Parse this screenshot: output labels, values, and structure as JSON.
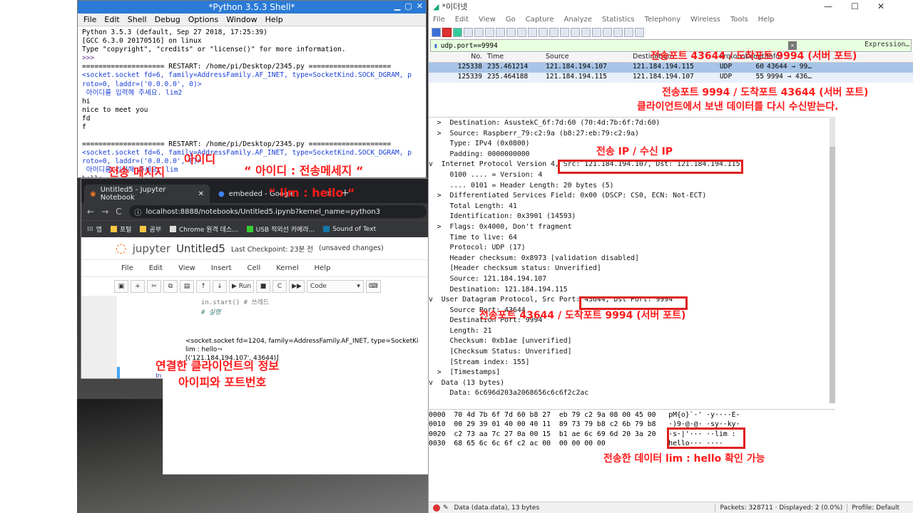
{
  "shell": {
    "title": "*Python 3.5.3 Shell*",
    "menu": [
      "File",
      "Edit",
      "Shell",
      "Debug",
      "Options",
      "Window",
      "Help"
    ],
    "lines": [
      {
        "t": "Python 3.5.3 (default, Sep 27 2018, 17:25:39)",
        "c": ""
      },
      {
        "t": "[GCC 6.3.0 20170516] on linux",
        "c": ""
      },
      {
        "t": "Type \"copyright\", \"credits\" or \"license()\" for more information.",
        "c": ""
      },
      {
        "t": ">>> ",
        "c": "purple"
      },
      {
        "t": "==================== RESTART: /home/pi/Desktop/2345.py ====================",
        "c": ""
      },
      {
        "t": "<socket.socket fd=6, family=AddressFamily.AF_INET, type=SocketKind.SOCK_DGRAM, p",
        "c": "blue"
      },
      {
        "t": "roto=0, laddr=('0.0.0.0', 0)>",
        "c": "blue"
      },
      {
        "t": " 아이디를 입력해 주세요. lim2",
        "c": "blue"
      },
      {
        "t": "hi",
        "c": ""
      },
      {
        "t": "nice to meet you",
        "c": ""
      },
      {
        "t": "fd",
        "c": ""
      },
      {
        "t": "f",
        "c": ""
      },
      {
        "t": "",
        "c": ""
      },
      {
        "t": "==================== RESTART: /home/pi/Desktop/2345.py ====================",
        "c": ""
      },
      {
        "t": "<socket.socket fd=6, family=AddressFamily.AF_INET, type=SocketKind.SOCK_DGRAM, p",
        "c": "blue"
      },
      {
        "t": "roto=0, laddr=('0.0.0.0', 0)>",
        "c": "blue"
      },
      {
        "t": " 아이디를 입력해 주세요. lim",
        "c": "blue"
      },
      {
        "t": "hello¬",
        "c": ""
      }
    ]
  },
  "chrome": {
    "tabs": [
      {
        "label": "Untitled5 - Jupyter Notebook",
        "close": "✕"
      },
      {
        "label": "embeded - Google",
        "close": "✕"
      }
    ],
    "new_tab": "+",
    "url": "localhost:8888/notebooks/Untitled5.ipynb?kernel_name=python3",
    "bookmarks": [
      "앱",
      "포털",
      "공부",
      "Chrome 원격 데스...",
      "USB 적외선 카메라...",
      "Sound of Text"
    ]
  },
  "jupyter": {
    "logo": "jupyter",
    "notebook_name": "Untitled5",
    "checkpoint": "Last Checkpoint: 23분 전",
    "status": "(unsaved changes)",
    "menu": [
      "File",
      "Edit",
      "View",
      "Insert",
      "Cell",
      "Kernel",
      "Help"
    ],
    "run_label": "Run",
    "cell_type": "Code",
    "code_lines": [
      "in.start() # 쓰레드",
      "# 실행"
    ],
    "output_lines": [
      "<socket.socket fd=1204, family=AddressFamily.AF_INET, type=SocketKi",
      "lim : hello¬",
      "[('121.184.194.107', 43644)]"
    ],
    "prompt": "In"
  },
  "wireshark": {
    "title": "*이더넷",
    "menu": [
      "File",
      "Edit",
      "View",
      "Go",
      "Capture",
      "Analyze",
      "Statistics",
      "Telephony",
      "Wireless",
      "Tools",
      "Help"
    ],
    "filter": "udp.port==9994",
    "expression": "Expression…",
    "columns": [
      "No.",
      "Time",
      "Source",
      "Destination",
      "Protocol",
      "Length",
      "Info"
    ],
    "packets": [
      {
        "no": "125338",
        "time": "235.461214",
        "src": "121.184.194.107",
        "dst": "121.184.194.115",
        "proto": "UDP",
        "len": "60",
        "info": "43644 → 99…"
      },
      {
        "no": "125339",
        "time": "235.464188",
        "src": "121.184.194.115",
        "dst": "121.184.194.107",
        "proto": "UDP",
        "len": "55",
        "info": "9994 → 436…"
      }
    ],
    "details": [
      "  >  Destination: AsustekC_6f:7d:60 (70:4d:7b:6f:7d:60)",
      "  >  Source: Raspberr_79:c2:9a (b8:27:eb:79:c2:9a)",
      "     Type: IPv4 (0x0800)",
      "     Padding: 0000000000",
      "v  Internet Protocol Version 4, Src: 121.184.194.107, Dst: 121.184.194.115",
      "     0100 .... = Version: 4",
      "     .... 0101 = Header Length: 20 bytes (5)",
      "  >  Differentiated Services Field: 0x00 (DSCP: CS0, ECN: Not-ECT)",
      "     Total Length: 41",
      "     Identification: 0x3901 (14593)",
      "  >  Flags: 0x4000, Don't fragment",
      "     Time to live: 64",
      "     Protocol: UDP (17)",
      "     Header checksum: 0x8973 [validation disabled]",
      "     [Header checksum status: Unverified]",
      "     Source: 121.184.194.107",
      "     Destination: 121.184.194.115",
      "v  User Datagram Protocol, Src Port: 43644, Dst Port: 9994",
      "     Source Port: 43644",
      "     Destination Port: 9994",
      "     Length: 21",
      "     Checksum: 0xb1ae [unverified]",
      "     [Checksum Status: Unverified]",
      "     [Stream index: 155]",
      "  >  [Timestamps]",
      "v  Data (13 bytes)",
      "     Data: 6c696d203a2068656c6c6f2c2ac"
    ],
    "hex": [
      "0000  70 4d 7b 6f 7d 60 b8 27  eb 79 c2 9a 08 00 45 00   pM{o}`·' ·y····E·",
      "0010  00 29 39 01 40 00 40 11  89 73 79 b8 c2 6b 79 b8   ·)9·@·@· ·sy··ky·",
      "0020  c2 73 aa 7c 27 0a 00 15  b1 ae 6c 69 6d 20 3a 20   ·s·|'··· ··lim : ",
      "0030  68 65 6c 6c 6f c2 ac 00  00 00 00 00               hello··· ····"
    ],
    "status_left": "Data (data.data), 13 bytes",
    "status_packets": "Packets: 328711 · Displayed: 2 (0.0%)",
    "status_profile": "Profile: Default"
  },
  "annotations": {
    "send_port_top": "전송포트 43644 / 도착포트 9994 (서버 포트)",
    "recv_port_1": "전송포트 9994 / 도착포트 43644 (서버 포트)",
    "recv_port_2": "클라이언트에서 보낸 데이터를 다시 수신받는다.",
    "ip_label": "전송 IP / 수신 IP",
    "udp_port": "전송포트 43644 / 도착포트 9994 (서버 포트)",
    "id_label": "아이디",
    "msg_label": "전송 메시지",
    "format_label": "“ 아이디 : 전송메세지 “",
    "example_label": "“ lim : hello “",
    "client_info_1": "연결한 클라이언트의 정보",
    "client_info_2": "아이피와 포트번호",
    "data_confirm": "전송한 데이터 lim : hello 확인 가능"
  }
}
